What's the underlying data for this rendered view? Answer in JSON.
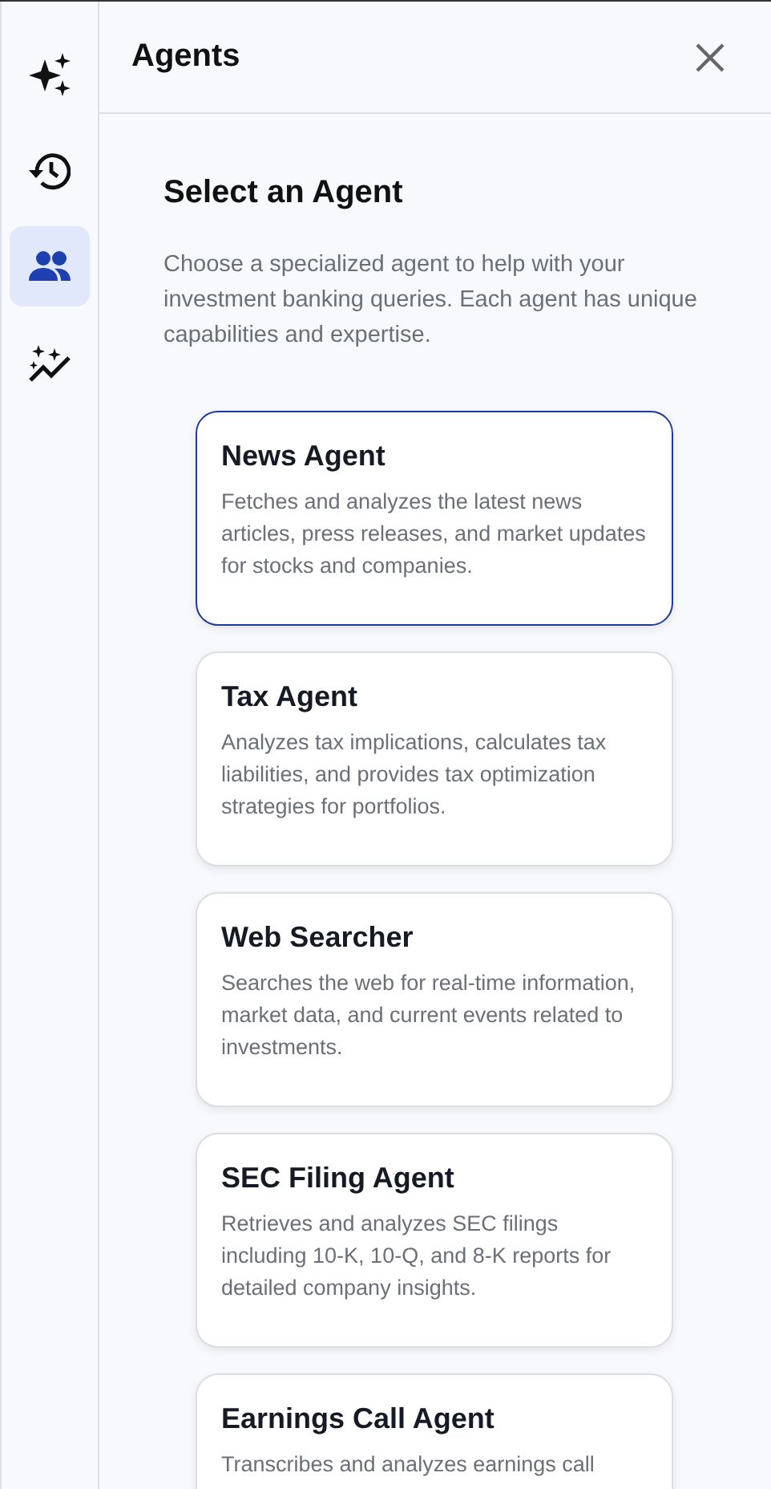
{
  "sidebar": {
    "items": [
      {
        "kind": "sparkles",
        "selected": false
      },
      {
        "kind": "history",
        "selected": false
      },
      {
        "kind": "people",
        "selected": true
      },
      {
        "kind": "trend",
        "selected": false
      }
    ]
  },
  "panel": {
    "title": "Agents",
    "heading": "Select an Agent",
    "intro": "Choose a specialized agent to help with your investment banking queries. Each agent has unique capabilities and expertise.",
    "agents": [
      {
        "name": "News Agent",
        "description": "Fetches and analyzes the latest news articles, press releases, and market updates for stocks and companies.",
        "selected": true
      },
      {
        "name": "Tax Agent",
        "description": "Analyzes tax implications, calculates tax liabilities, and provides tax optimization strategies for portfolios.",
        "selected": false
      },
      {
        "name": "Web Searcher",
        "description": "Searches the web for real-time information, market data, and current events related to investments.",
        "selected": false
      },
      {
        "name": "SEC Filing Agent",
        "description": "Retrieves and analyzes SEC filings including 10-K, 10-Q, and 8-K reports for detailed company insights.",
        "selected": false
      },
      {
        "name": "Earnings Call Agent",
        "description": "Transcribes and analyzes earnings call",
        "selected": false
      }
    ]
  }
}
